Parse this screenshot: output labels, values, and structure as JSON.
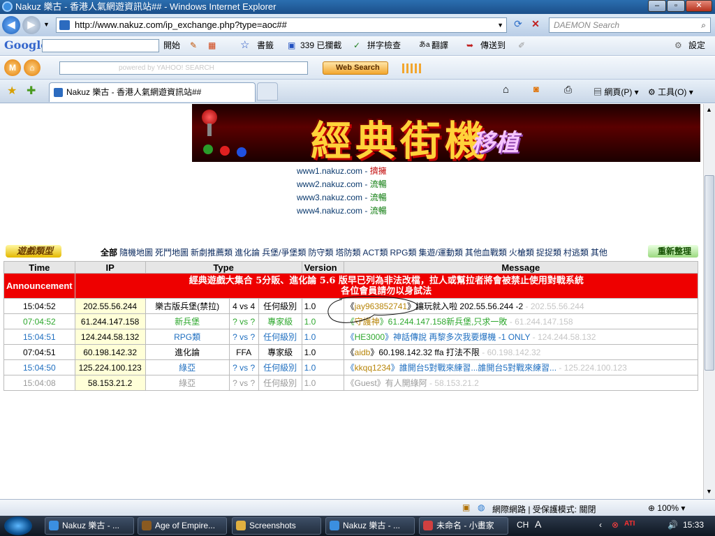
{
  "window": {
    "title": "Nakuz 樂古 - 香港人氣網遊資訊站## - Windows Internet Explorer"
  },
  "address": {
    "url": "http://www.nakuz.com/ip_exchange.php?type=aoc##",
    "search_placeholder": "DAEMON Search"
  },
  "google_toolbar": {
    "brand": "Google",
    "start": "開始",
    "blocked": "339 已攔截",
    "bookmarks": "書籤",
    "spell": "拼字檢查",
    "translate": "翻譯",
    "sendto": "傳送到",
    "settings": "設定"
  },
  "yahoo_toolbar": {
    "placeholder": "powered by YAHOO! SEARCH",
    "web_search": "Web Search"
  },
  "tab": {
    "title": "Nakuz 樂古 - 香港人氣網遊資訊站##"
  },
  "command_bar": {
    "page": "網頁(P)",
    "tools": "工具(O)"
  },
  "banner": {
    "title": "經典街機",
    "subtitle": "移植"
  },
  "mirrors": [
    {
      "host": "www1.nakuz.com",
      "sep": " - ",
      "status": "擠擁",
      "busy": true
    },
    {
      "host": "www2.nakuz.com",
      "sep": " - ",
      "status": "流暢",
      "busy": false
    },
    {
      "host": "www3.nakuz.com",
      "sep": " - ",
      "status": "流暢",
      "busy": false
    },
    {
      "host": "www4.nakuz.com",
      "sep": " - ",
      "status": "流暢",
      "busy": false
    }
  ],
  "categories": {
    "logo": "遊戲類型",
    "items": [
      "全部",
      "隨機地圖",
      "死鬥地圖",
      "新劇推薦類",
      "進化論",
      "兵堡/爭堡類",
      "防守類",
      "塔防類",
      "ACT類",
      "RPG類",
      "集遊/運動類",
      "其他血戰類",
      "火槍類",
      "捉捉類",
      "村逃類",
      "其他"
    ],
    "refresh": "重新整理"
  },
  "table": {
    "headers": {
      "time": "Time",
      "ip": "IP",
      "type": "Type",
      "version": "Version",
      "message": "Message"
    },
    "announcement": {
      "label": "Announcement",
      "line1": "經典遊戲大集合 5分販、進化論 5.6 版早已列為非法改檔，拉人或幫拉者將會被禁止使用對戰系統",
      "line2": "各位會員請勿以身試法"
    },
    "rows": [
      {
        "time": "15:04:52",
        "ip": "202.55.56.244",
        "type": "樂古版兵堡(禁拉)",
        "mode": "4 vs 4",
        "level": "任何級別",
        "ver": "1.0",
        "user": "jay963852741",
        "msg": "讓玩就入啦 202.55.56.244 -2",
        "ghost": "- 202.55.56.244",
        "color": "#000000",
        "timecolor": "#000000",
        "usercolor": "#b8860b"
      },
      {
        "time": "07:04:52",
        "ip": "61.244.147.158",
        "type": "新兵堡",
        "mode": "? vs ?",
        "level": "專家級",
        "ver": "1.0",
        "user": "守護神",
        "msg": "61.244.147.158新兵堡,只求一敗",
        "ghost": "- 61.244.147.158",
        "color": "#2fa82f",
        "timecolor": "#2fa82f",
        "usercolor": "#b8860b"
      },
      {
        "time": "15:04:51",
        "ip": "124.244.58.132",
        "type": "RPG類",
        "mode": "? vs ?",
        "level": "任何級別",
        "ver": "1.0",
        "user": "HE3000",
        "msg": "神話傳說 再黎多次我要爆機 -1 ONLY",
        "ghost": "- 124.244.58.132",
        "color": "#1f6fc0",
        "timecolor": "#1f6fc0",
        "usercolor": "#2fa82f"
      },
      {
        "time": "07:04:51",
        "ip": "60.198.142.32",
        "type": "進化論",
        "mode": "FFA",
        "level": "專家級",
        "ver": "1.0",
        "user": "aidb",
        "msg": "60.198.142.32 ffa 打法不限",
        "ghost": "- 60.198.142.32",
        "color": "#000000",
        "timecolor": "#000000",
        "usercolor": "#b8860b"
      },
      {
        "time": "15:04:50",
        "ip": "125.224.100.123",
        "type": "綠亞",
        "mode": "? vs ?",
        "level": "任何級別",
        "ver": "1.0",
        "user": "kkqq1234",
        "msg": "誰開台5對戰來練習...誰開台5對戰來練習...",
        "ghost": "- 125.224.100.123",
        "color": "#1f6fc0",
        "timecolor": "#1f6fc0",
        "usercolor": "#b8860b"
      },
      {
        "time": "15:04:08",
        "ip": "58.153.21.2",
        "type": "綠亞",
        "mode": "? vs ?",
        "level": "任何級別",
        "ver": "1.0",
        "user": "Guest",
        "msg": "有人開綠阿",
        "ghost": "- 58.153.21.2",
        "color": "#9a9a9a",
        "timecolor": "#9a9a9a",
        "usercolor": "#9a9a9a"
      }
    ]
  },
  "statusbar": {
    "zone": "網際網路 | 受保護模式: 關閉",
    "zoom": "100%"
  },
  "taskbar": {
    "tasks": [
      "Nakuz 樂古 - ...",
      "Age of Empire...",
      "Screenshots",
      "Nakuz 樂古 - ...",
      "未命名 - 小畫家"
    ],
    "lang": "CH",
    "clock": "15:33"
  }
}
